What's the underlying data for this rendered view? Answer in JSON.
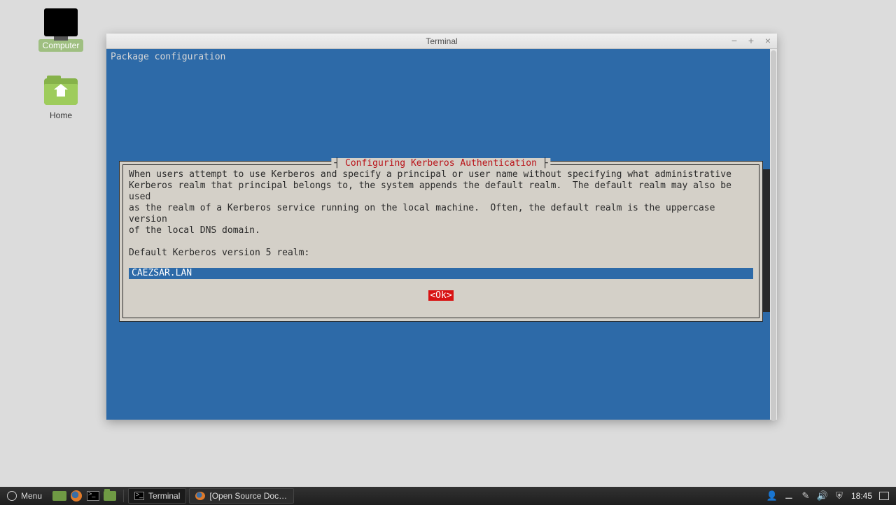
{
  "desktop": {
    "computer_label": "Computer",
    "home_label": "Home"
  },
  "window": {
    "title": "Terminal",
    "min_tip": "−",
    "max_tip": "+",
    "close_tip": "×"
  },
  "term": {
    "pkg_line": "Package configuration",
    "dialog_title": "Configuring Kerberos Authentication",
    "body_text": "When users attempt to use Kerberos and specify a principal or user name without specifying what administrative\nKerberos realm that principal belongs to, the system appends the default realm.  The default realm may also be used\nas the realm of a Kerberos service running on the local machine.  Often, the default realm is the uppercase version\nof the local DNS domain.",
    "prompt": "Default Kerberos version 5 realm:",
    "input_value": "CAEZSAR.LAN",
    "ok_label": "<Ok>"
  },
  "taskbar": {
    "menu_label": "Menu",
    "tasks": [
      {
        "label": "Terminal"
      },
      {
        "label": "[Open Source Docum..."
      }
    ],
    "clock": "18:45"
  }
}
